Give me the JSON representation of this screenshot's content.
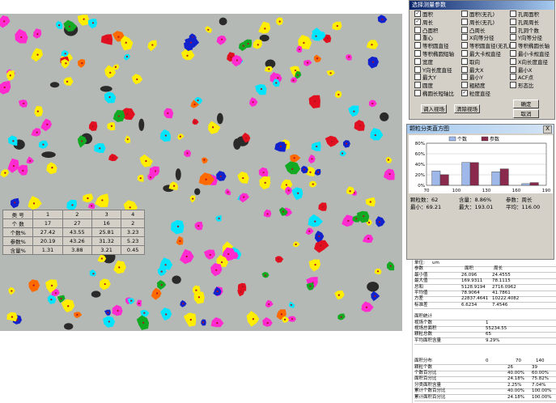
{
  "params_window": {
    "title": "选择测量参数",
    "items": [
      {
        "label": "面积",
        "checked": true
      },
      {
        "label": "面积(无孔)",
        "checked": false
      },
      {
        "label": "孔周面积",
        "checked": false
      },
      {
        "label": "周长",
        "checked": true
      },
      {
        "label": "周长(无孔)",
        "checked": false
      },
      {
        "label": "孔周周长",
        "checked": false
      },
      {
        "label": "凸面积",
        "checked": false
      },
      {
        "label": "凸周长",
        "checked": false
      },
      {
        "label": "孔洞个数",
        "checked": false
      },
      {
        "label": "重心",
        "checked": false
      },
      {
        "label": "X向等分径",
        "checked": false
      },
      {
        "label": "Y向等分径",
        "checked": false
      },
      {
        "label": "等积圆直径",
        "checked": false
      },
      {
        "label": "等积圆直径(无孔)",
        "checked": false
      },
      {
        "label": "等积椭圆长轴",
        "checked": false
      },
      {
        "label": "等积椭圆短轴",
        "checked": false
      },
      {
        "label": "最大卡规直径",
        "checked": false
      },
      {
        "label": "最小卡规直径",
        "checked": false
      },
      {
        "label": "宽度",
        "checked": false
      },
      {
        "label": "取向",
        "checked": false
      },
      {
        "label": "X向长度直径",
        "checked": false
      },
      {
        "label": "Y向长度直径",
        "checked": false
      },
      {
        "label": "最大X",
        "checked": false
      },
      {
        "label": "最小X",
        "checked": false
      },
      {
        "label": "最大Y",
        "checked": false
      },
      {
        "label": "最小Y",
        "checked": false
      },
      {
        "label": "ACF点",
        "checked": false
      },
      {
        "label": "圆度",
        "checked": false
      },
      {
        "label": "粗糙度",
        "checked": false
      },
      {
        "label": "形态比",
        "checked": false
      },
      {
        "label": "椭圆长短轴比",
        "checked": false
      },
      {
        "label": "粒度直径",
        "checked": true
      }
    ],
    "btn_load": "调入视场",
    "btn_cancel_field": "清除视场",
    "btn_ok": "确定",
    "btn_cancel": "取消"
  },
  "histogram_window": {
    "title": "颗粒分类直方图",
    "close": "X",
    "legend": [
      {
        "label": "个数",
        "color": "#9fb8ea"
      },
      {
        "label": "参数",
        "color": "#8a2a4c"
      }
    ],
    "stats": {
      "line1": [
        "颗粒数：62",
        "含量：8.86%",
        "参数：周长"
      ],
      "line2": [
        "最小：69.21",
        "最大：193.01",
        "平均：116.00"
      ]
    },
    "table": {
      "header": [
        "类 号",
        "1",
        "2",
        "3",
        "4"
      ],
      "rows": [
        [
          "个 数",
          "17",
          "27",
          "16",
          "2"
        ],
        [
          "个数%",
          "27.42",
          "43.55",
          "25.81",
          "3.23"
        ],
        [
          "参数%",
          "20.19",
          "43.26",
          "31.32",
          "5.23"
        ],
        [
          "含量%",
          "1.31",
          "3.88",
          "3.21",
          "0.45"
        ]
      ]
    }
  },
  "chart_data": {
    "type": "bar",
    "categories": [
      "70-100",
      "100-130",
      "130-160",
      "160-190"
    ],
    "x_ticks": [
      "70",
      "100",
      "130",
      "160",
      "190"
    ],
    "y_ticks": [
      "0%",
      "20%",
      "40%",
      "60%",
      "80%"
    ],
    "ylim": [
      0,
      80
    ],
    "series": [
      {
        "name": "个数",
        "values": [
          27.42,
          43.55,
          25.81,
          3.23
        ],
        "color": "#9fb8ea"
      },
      {
        "name": "参数",
        "values": [
          20.19,
          43.26,
          31.32,
          5.23
        ],
        "color": "#8a2a4c"
      }
    ]
  },
  "report": {
    "header1": [
      "单位:",
      "um"
    ],
    "header2": [
      "参数",
      "面积",
      "周长"
    ],
    "stats": [
      [
        "最小值",
        "26.096",
        "24.4555"
      ],
      [
        "最大值",
        "169.9311",
        "78.1115"
      ],
      [
        "总和",
        "5128.9194",
        "2716.0962"
      ],
      [
        "平均值",
        "78.9064",
        "41.7861"
      ],
      [
        "方差",
        "22837.4641",
        "10222.4082"
      ],
      [
        "标准差",
        "6.6234",
        "7.4546"
      ]
    ],
    "field_title": "面积统计",
    "field_rows": [
      [
        "视场个数",
        "1"
      ],
      [
        "视场总面积",
        "55234.55"
      ],
      [
        "颗粒总数",
        "65"
      ],
      [
        "平均面积含量",
        "9.29%"
      ]
    ],
    "dist_rows": [
      [
        "面积分布",
        "0",
        "70",
        "140"
      ],
      [
        "颗粒个数",
        "26",
        "39"
      ],
      [
        "个数百分比",
        "40.00%",
        "60.00%"
      ],
      [
        "面积百分比",
        "24.18%",
        "75.82%"
      ],
      [
        "分类面积含量",
        "2.25%",
        "7.04%"
      ],
      [
        "累计个数百分比",
        "40.00%",
        "100.00%"
      ],
      [
        "累计面积百分比",
        "24.18%",
        "100.00%"
      ]
    ]
  }
}
